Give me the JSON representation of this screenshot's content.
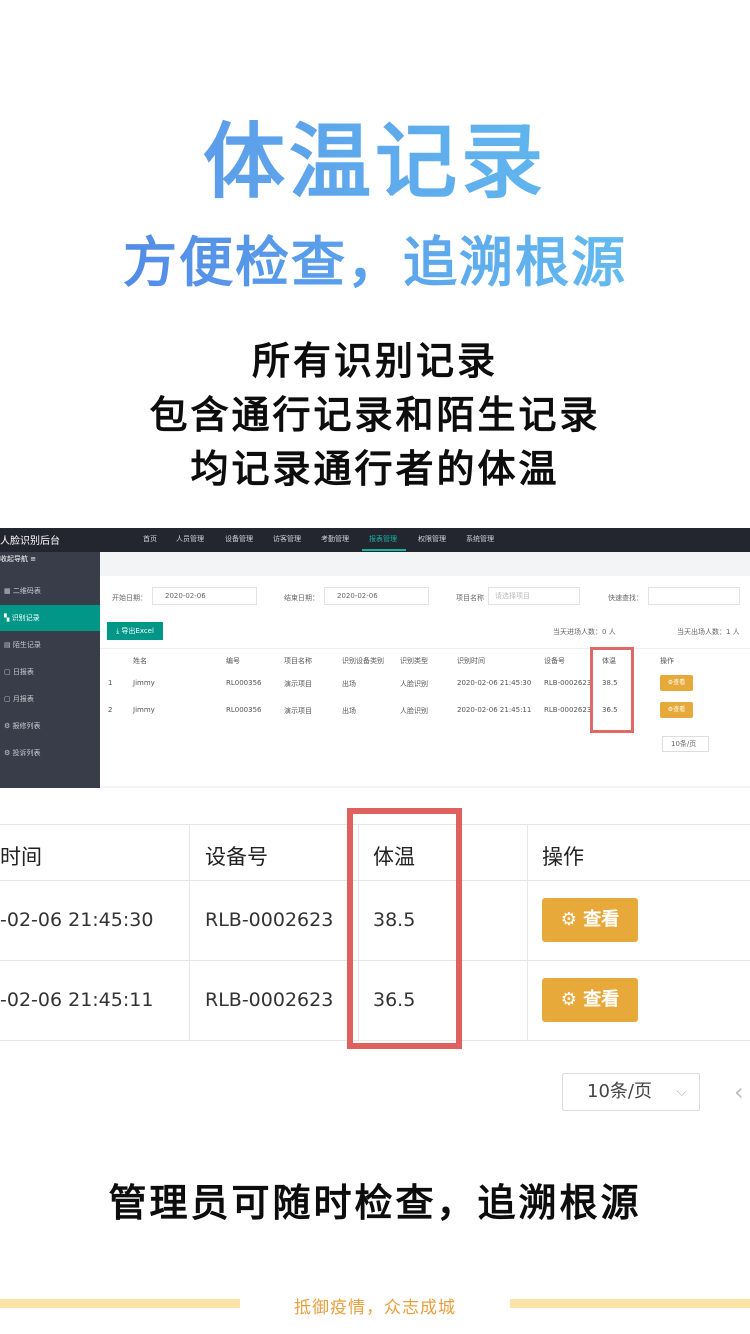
{
  "hero": {
    "title": "体温记录",
    "subtitle": "方便检查，追溯根源"
  },
  "description": [
    "所有识别记录",
    "包含通行记录和陌生记录",
    "均记录通行者的体温"
  ],
  "admin": {
    "brand": "人脸识别后台",
    "nav": [
      "首页",
      "人员管理",
      "设备管理",
      "访客管理",
      "考勤管理",
      "报表管理",
      "权限管理",
      "系统管理"
    ],
    "active_nav": "报表管理",
    "side_head": "收起导航 ≡",
    "sidebar": [
      "二维码表",
      "识别记录",
      "陌生记录",
      "日报表",
      "月报表",
      "报修列表",
      "投诉列表"
    ],
    "filters": {
      "start_label": "开始日期：",
      "start_value": "2020-02-06",
      "end_label": "结束日期：",
      "end_value": "2020-02-06",
      "project_label": "项目名称",
      "project_placeholder": "请选择项目",
      "quick_label": "快速查找："
    },
    "export_label": "导出Excel",
    "stats_in": "当天进场人数：0 人",
    "stats_out": "当天出场人数：1 人",
    "columns": [
      "姓名",
      "编号",
      "项目名称",
      "识别设备类别",
      "识别类型",
      "识别时间",
      "设备号",
      "体温",
      "操作"
    ],
    "rows": [
      {
        "idx": "1",
        "name": "Jimmy",
        "code": "RL000356",
        "project": "演示项目",
        "device_type": "出场",
        "recog_type": "人脸识别",
        "time": "2020-02-06 21:45:30",
        "device": "RLB-0002623",
        "temp": "38.5",
        "action": "查看"
      },
      {
        "idx": "2",
        "name": "Jimmy",
        "code": "RL000356",
        "project": "演示项目",
        "device_type": "出场",
        "recog_type": "人脸识别",
        "time": "2020-02-06 21:45:11",
        "device": "RLB-0002623",
        "temp": "36.5",
        "action": "查看"
      }
    ],
    "pager": "10条/页"
  },
  "zoom": {
    "headers": [
      "时间",
      "设备号",
      "体温",
      "操作"
    ],
    "rows": [
      {
        "time": "-02-06 21:45:30",
        "device": "RLB-0002623",
        "temp": "38.5",
        "action": "查看"
      },
      {
        "time": "-02-06 21:45:11",
        "device": "RLB-0002623",
        "temp": "36.5",
        "action": "查看"
      }
    ],
    "pager": "10条/页",
    "pager_prev": "‹"
  },
  "bottom_text": "管理员可随时检查，追溯根源",
  "footer_text": "抵御疫情，众志成城",
  "colors": {
    "accent_teal": "#009688",
    "view_button": "#e8a93b",
    "highlight_red": "#e06060",
    "footer": "#e7a03f"
  }
}
